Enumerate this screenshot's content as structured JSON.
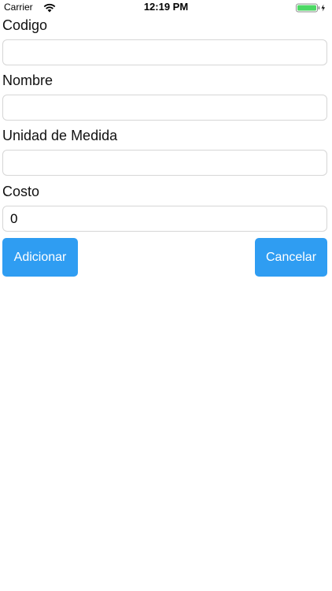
{
  "status_bar": {
    "carrier": "Carrier",
    "time": "12:19 PM",
    "battery_color": "#4cd964"
  },
  "form": {
    "codigo": {
      "label": "Codigo",
      "value": ""
    },
    "nombre": {
      "label": "Nombre",
      "value": ""
    },
    "unidad": {
      "label": "Unidad de Medida",
      "value": ""
    },
    "costo": {
      "label": "Costo",
      "value": "0"
    }
  },
  "actions": {
    "add_label": "Adicionar",
    "cancel_label": "Cancelar",
    "button_color": "#2f9df2"
  }
}
